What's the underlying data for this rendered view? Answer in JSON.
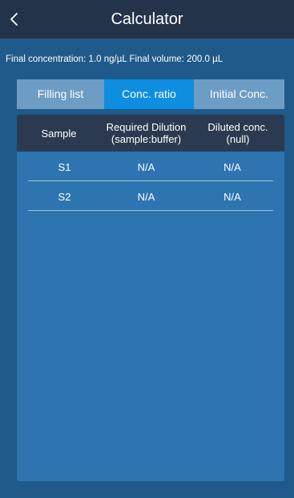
{
  "header": {
    "title": "Calculator",
    "back_icon": "chevron-left-icon"
  },
  "info": {
    "text": "Final concentration: 1.0 ng/µL  Final volume: 200.0 µL"
  },
  "tabs": [
    {
      "label": "Filling list",
      "active": false
    },
    {
      "label": "Conc. ratio",
      "active": true
    },
    {
      "label": "Initial Conc.",
      "active": false
    }
  ],
  "table": {
    "columns": [
      "Sample",
      "Required Dilution\n(sample:buffer)",
      "Diluted conc.\n(null)"
    ],
    "rows": [
      {
        "sample": "S1",
        "dilution": "N/A",
        "diluted": "N/A"
      },
      {
        "sample": "S2",
        "dilution": "N/A",
        "diluted": "N/A"
      }
    ]
  },
  "colors": {
    "background": "#1f5a8a",
    "appbar": "#24334a",
    "active_tab": "#0d8ee0",
    "inactive_tab": "#6d9cc4",
    "panel": "#2d74b0",
    "table_header": "#2b3a50"
  }
}
